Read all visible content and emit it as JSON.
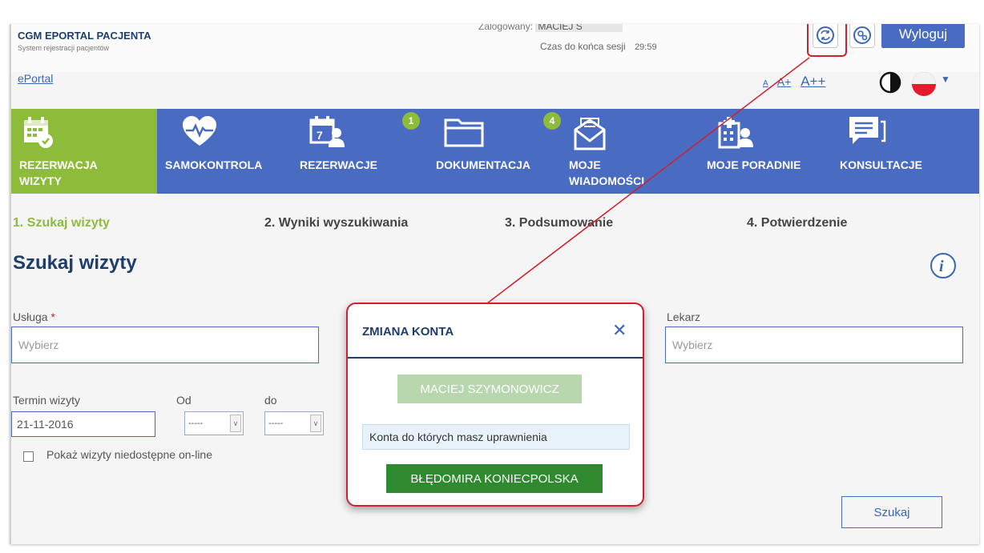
{
  "header": {
    "brand_title": "CGM EPORTAL PACJENTA",
    "brand_subtitle": "System rejestracji pacjentów",
    "logged_label": "Zalogowany:",
    "logged_user": "MACIEJ S",
    "session_label": "Czas do końca sesji",
    "session_time": "29:59",
    "logout_label": "Wyloguj",
    "eportal_link": "ePortal",
    "font_a": "A",
    "font_aplus": "A+",
    "font_aplusplus": "A++"
  },
  "nav": {
    "items": [
      {
        "label_line1": "REZERWACJA",
        "label_line2": "WIZYTY",
        "icon": "calendar-check-icon",
        "active": true
      },
      {
        "label_line1": "SAMOKONTROLA",
        "label_line2": "",
        "icon": "heart-pulse-icon"
      },
      {
        "label_line1": "REZERWACJE",
        "label_line2": "",
        "icon": "calendar-person-icon"
      },
      {
        "label_line1": "DOKUMENTACJA",
        "label_line2": "",
        "icon": "folder-icon",
        "badge": "1"
      },
      {
        "label_line1": "MOJE",
        "label_line2": "WIADOMOŚCI",
        "icon": "envelope-icon",
        "badge": "4"
      },
      {
        "label_line1": "MOJE PORADNIE",
        "label_line2": "",
        "icon": "clinic-icon"
      },
      {
        "label_line1": "KONSULTACJE",
        "label_line2": "",
        "icon": "chat-icon"
      }
    ]
  },
  "steps": [
    "1. Szukaj wizyty",
    "2. Wyniki wyszukiwania",
    "3. Podsumowanie",
    "4. Potwierdzenie"
  ],
  "form": {
    "title": "Szukaj wizyty",
    "service_label": "Usługa",
    "service_required": "*",
    "service_placeholder": "Wybierz",
    "doctor_label": "Lekarz",
    "doctor_placeholder": "Wybierz",
    "term_label": "Termin wizyty",
    "date_value": "21-11-2016",
    "from_label": "Od",
    "to_label": "do",
    "from_value": "-----",
    "to_value": "-----",
    "show_unavailable": "Pokaż wizyty niedostępne on-line",
    "search_button": "Szukaj"
  },
  "modal": {
    "title": "ZMIANA KONTA",
    "current_account": "MACIEJ SZYMONOWICZ",
    "accounts_header": "Konta do których masz uprawnienia",
    "accounts": [
      "BŁĘDOMIRA KONIECPOLSKA"
    ]
  },
  "colors": {
    "nav_blue": "#4a6bc2",
    "active_green": "#8dbb3a",
    "highlight_red": "#d0202e",
    "account_green": "#2f8a2f"
  }
}
